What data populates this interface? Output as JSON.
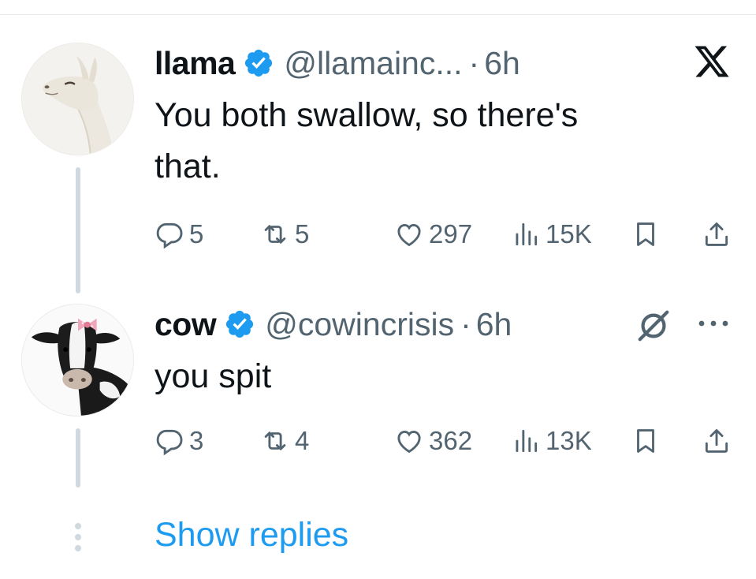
{
  "tweets": [
    {
      "name": "llama",
      "handle": "@llamainc...",
      "separator": "·",
      "time": "6h",
      "text_lines": [
        "You both swallow, so there's",
        "that."
      ],
      "stats": {
        "replies": "5",
        "reposts": "5",
        "likes": "297",
        "views": "15K"
      },
      "avatar_icon": "llama-avatar"
    },
    {
      "name": "cow",
      "handle": "@cowincrisis",
      "separator": "·",
      "time": "6h",
      "text_lines": [
        "you spit"
      ],
      "stats": {
        "replies": "3",
        "reposts": "4",
        "likes": "362",
        "views": "13K"
      },
      "avatar_icon": "cow-avatar"
    }
  ],
  "show_replies": "Show replies",
  "colors": {
    "text": "#0f1419",
    "muted": "#536471",
    "accent": "#1d9bf0",
    "verified": "#1d9bf0",
    "thread_line": "#cfd9de"
  },
  "icons": [
    "x-logo-icon",
    "grok-icon",
    "more-icon",
    "reply-icon",
    "repost-icon",
    "like-icon",
    "views-icon",
    "bookmark-icon",
    "share-icon",
    "verified-badge-icon",
    "vertical-dots-icon"
  ]
}
